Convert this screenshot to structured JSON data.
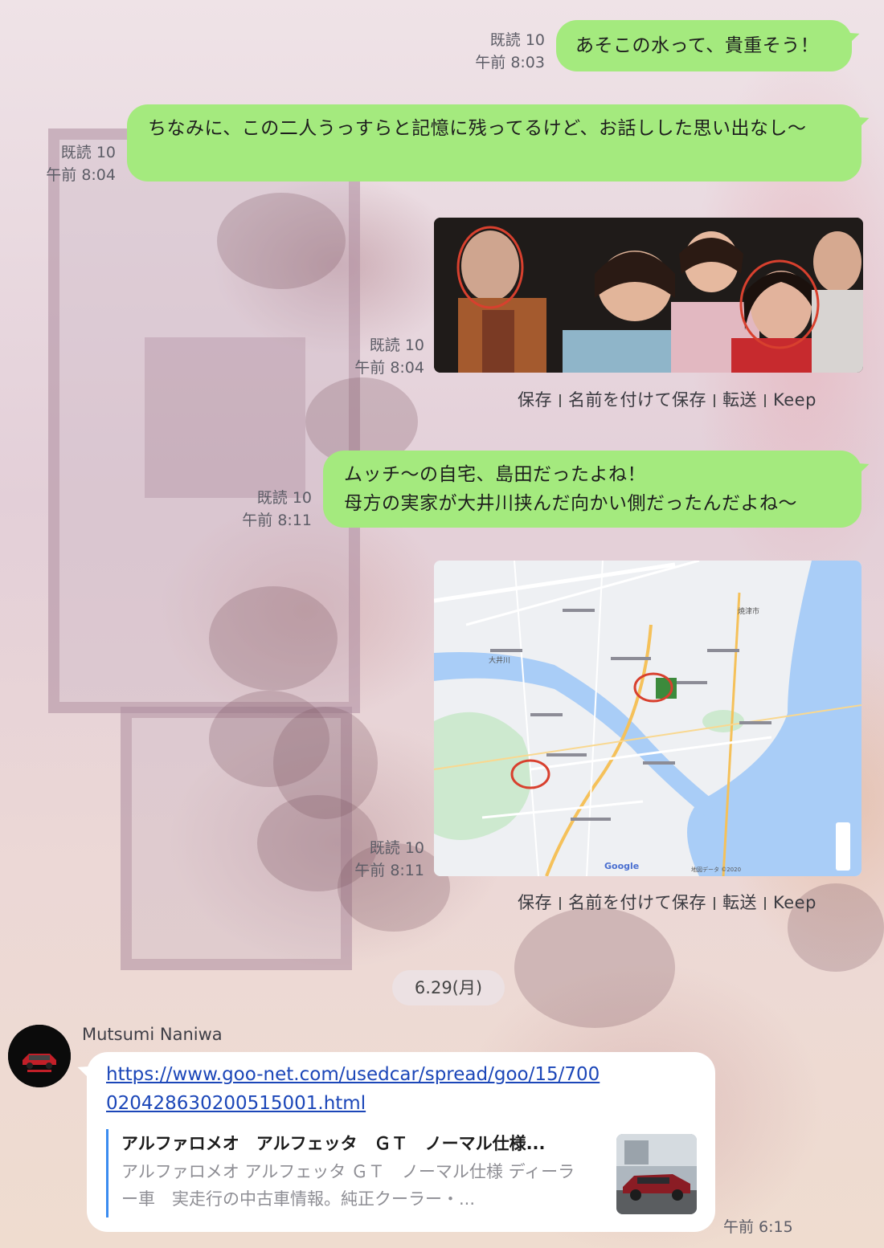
{
  "messages": [
    {
      "read": "既読 10",
      "time": "午前 8:03",
      "text": "あそこの水って、貴重そう！"
    },
    {
      "read": "既読 10",
      "time": "午前 8:04",
      "text": "ちなみに、この二人うっすらと記憶に残ってるけど、お話しした思い出なし〜"
    },
    {
      "read": "既読 10",
      "time": "午前 8:04",
      "type": "image"
    },
    {
      "read": "既読 10",
      "time": "午前 8:11",
      "line1": "ムッチ〜の自宅、島田だったよね！",
      "line2": "母方の実家が大井川挟んだ向かい側だったんだよね〜"
    },
    {
      "read": "既読 10",
      "time": "午前 8:11",
      "type": "map-image"
    }
  ],
  "image_actions": {
    "save": "保存",
    "save_as": "名前を付けて保存",
    "forward": "転送",
    "keep": "Keep"
  },
  "map": {
    "city_label": "焼津市",
    "river_label": "大井川",
    "google": "Google",
    "data_label": "地図データ ©2020"
  },
  "date_divider": "6.29(月)",
  "incoming": {
    "sender": "Mutsumi Naniwa",
    "url": "https://www.goo-net.com/usedcar/spread/goo/15/700020428630200515001.html",
    "preview_title": "アルファロメオ　アルフェッタ　ＧＴ　ノーマル仕様...",
    "preview_desc": "アルファロメオ アルフェッタ ＧＴ　ノーマル仕様 ディーラー車　実走行の中古車情報。純正クーラー・...",
    "time": "午前 6:15"
  },
  "colors": {
    "outgoing_bubble": "#a4ea7e",
    "incoming_bubble": "#ffffff",
    "link": "#1b46b8",
    "circle": "#d8402e"
  }
}
